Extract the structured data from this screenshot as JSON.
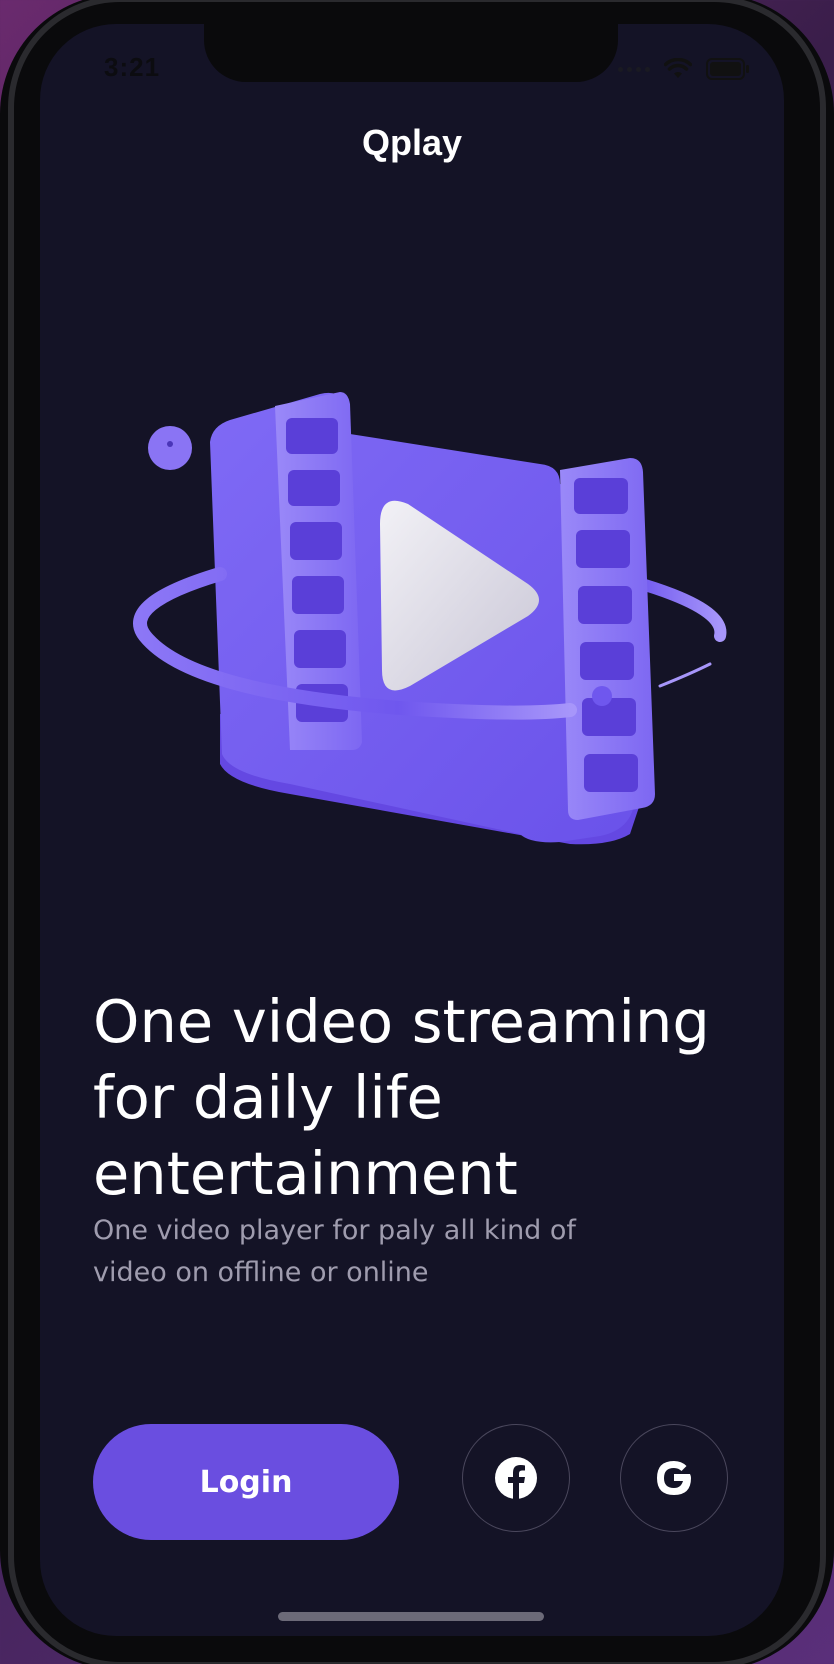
{
  "status_bar": {
    "time": "3:21",
    "icons": [
      "signal-dots-icon",
      "wifi-icon",
      "battery-icon"
    ]
  },
  "app": {
    "title": "Qplay"
  },
  "hero": {
    "illustration": "film-strip-play-icon",
    "colors": {
      "primary": "#7a62f0",
      "light": "#9b8cf7",
      "play": "#e4e2ea"
    }
  },
  "onboarding": {
    "headline": "One video streaming for daily life entertainment",
    "description": "One video player for paly all kind of video on offline or online"
  },
  "actions": {
    "login_label": "Login",
    "facebook_icon": "facebook-icon",
    "google_icon": "google-icon"
  },
  "theme": {
    "background": "#141326",
    "accent": "#6a4ee0",
    "text_primary": "#ffffff",
    "text_secondary": "#9f9cae"
  }
}
